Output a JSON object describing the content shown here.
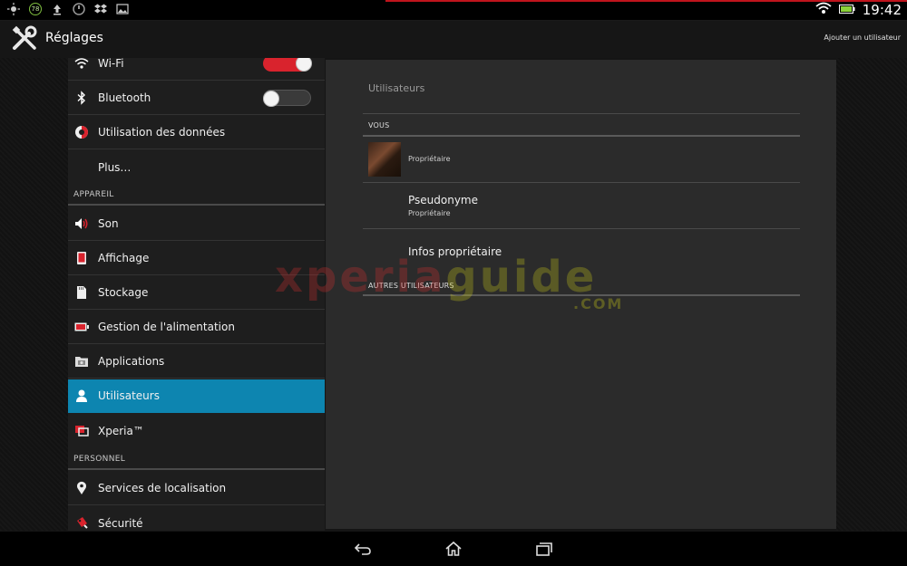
{
  "status_bar": {
    "notification_icons": [
      "sun-icon",
      "badge-78-icon",
      "upload-icon",
      "gauge-icon",
      "dropbox-icon",
      "image-icon"
    ],
    "badge_value": "78",
    "clock": "19:42"
  },
  "action_bar": {
    "title": "Réglages",
    "add_user_label": "Ajouter un utilisateur"
  },
  "sidebar": {
    "items": [
      {
        "label": "Wi-Fi",
        "icon": "wifi-icon",
        "toggle": "on"
      },
      {
        "label": "Bluetooth",
        "icon": "bluetooth-icon",
        "toggle": "off"
      },
      {
        "label": "Utilisation des données",
        "icon": "data-usage-icon"
      },
      {
        "label": "Plus…",
        "icon": ""
      },
      {
        "section": "APPAREIL"
      },
      {
        "label": "Son",
        "icon": "speaker-icon"
      },
      {
        "label": "Affichage",
        "icon": "display-icon"
      },
      {
        "label": "Stockage",
        "icon": "storage-icon"
      },
      {
        "label": "Gestion de l'alimentation",
        "icon": "battery-icon"
      },
      {
        "label": "Applications",
        "icon": "applications-icon"
      },
      {
        "label": "Utilisateurs",
        "icon": "user-icon",
        "selected": true
      },
      {
        "label": "Xperia™",
        "icon": "xperia-icon"
      },
      {
        "section": "PERSONNEL"
      },
      {
        "label": "Services de localisation",
        "icon": "location-icon"
      },
      {
        "label": "Sécurité",
        "icon": "lock-icon"
      }
    ]
  },
  "detail": {
    "title": "Utilisateurs",
    "section_you": "VOUS",
    "owner_label": "Propriétaire",
    "pseudonym_title": "Pseudonyme",
    "pseudonym_sub": "Propriétaire",
    "owner_info": "Infos propriétaire",
    "section_others": "AUTRES UTILISATEURS"
  },
  "watermark": {
    "part1": "xperia",
    "part2": "guide",
    "suffix": ".COM"
  },
  "nav_bar": {
    "buttons": [
      "back-icon",
      "home-icon",
      "recent-apps-icon"
    ]
  },
  "colors": {
    "accent_red": "#d9232d",
    "selection_blue": "#0d85b0"
  }
}
